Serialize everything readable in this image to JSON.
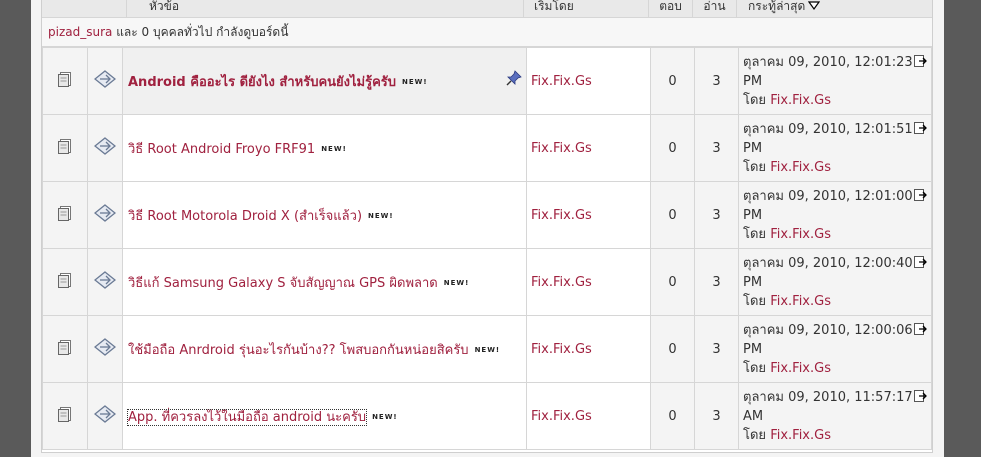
{
  "header": {
    "col_title": "หัวข้อ",
    "col_starter": "เริ่มโดย",
    "col_replies": "ตอบ",
    "col_views": "อ่าน",
    "col_last": "กระทู้ล่าสุด"
  },
  "viewers": {
    "user": "pizad_sura",
    "text": " และ 0 บุคคลทั่วไป กำลังดูบอร์ดนี้"
  },
  "threads": [
    {
      "title": "Android คืออะไร ดียังไง สำหรับคนยังไม่รู้ครับ",
      "new": "NEW!",
      "starter": "Fix.Fix.Gs",
      "replies": "0",
      "views": "3",
      "last_date": "ตุลาคม 09, 2010, 12:01:23",
      "last_ampm": "PM",
      "by_label": "โดย",
      "last_by": "Fix.Fix.Gs"
    },
    {
      "title": "วิธี Root Android Froyo FRF91",
      "new": "NEW!",
      "starter": "Fix.Fix.Gs",
      "replies": "0",
      "views": "3",
      "last_date": "ตุลาคม 09, 2010, 12:01:51",
      "last_ampm": "PM",
      "by_label": "โดย",
      "last_by": "Fix.Fix.Gs"
    },
    {
      "title": "วิธี Root Motorola Droid X (สำเร็จแล้ว)",
      "new": "NEW!",
      "starter": "Fix.Fix.Gs",
      "replies": "0",
      "views": "3",
      "last_date": "ตุลาคม 09, 2010, 12:01:00",
      "last_ampm": "PM",
      "by_label": "โดย",
      "last_by": "Fix.Fix.Gs"
    },
    {
      "title": "วิธีแก้ Samsung Galaxy S จับสัญญาณ GPS ผิดพลาด",
      "new": "NEW!",
      "starter": "Fix.Fix.Gs",
      "replies": "0",
      "views": "3",
      "last_date": "ตุลาคม 09, 2010, 12:00:40",
      "last_ampm": "PM",
      "by_label": "โดย",
      "last_by": "Fix.Fix.Gs"
    },
    {
      "title": "ใช้มือถือ Anrdroid รุ่นอะไรกันบ้าง?? โพสบอกกันหน่อยสิครับ",
      "new": "NEW!",
      "starter": "Fix.Fix.Gs",
      "replies": "0",
      "views": "3",
      "last_date": "ตุลาคม 09, 2010, 12:00:06",
      "last_ampm": "PM",
      "by_label": "โดย",
      "last_by": "Fix.Fix.Gs"
    },
    {
      "title": "App. ที่ควรลงไว้ในมือถือ android นะครับ",
      "new": "NEW!",
      "starter": "Fix.Fix.Gs",
      "replies": "0",
      "views": "3",
      "last_date": "ตุลาคม 09, 2010, 11:57:17",
      "last_ampm": "AM",
      "by_label": "โดย",
      "last_by": "Fix.Fix.Gs"
    }
  ],
  "colors": {
    "link": "#a0213f",
    "cell_alt": "#f4f4f4",
    "border": "#d6d6d6"
  },
  "icons": {
    "topic": "topic-icon",
    "post": "post-icon",
    "sticky": "pin-icon",
    "last_post": "last-post-icon",
    "sort": "sort-desc-icon"
  }
}
